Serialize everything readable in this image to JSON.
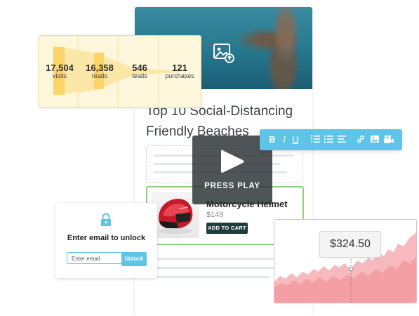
{
  "article": {
    "title_line1": "Top 10 Social-Distancing",
    "title_line2": "Friendly Beaches",
    "hero_icon": "image-upload-icon"
  },
  "product": {
    "name": "Motorcycle Helmet",
    "price": "$149",
    "cart_label": "ADD TO CART"
  },
  "video": {
    "label": "PRESS PLAY",
    "icon": "play-icon"
  },
  "toolbar": {
    "items": [
      "B",
      "I",
      "U"
    ],
    "icons": [
      "ordered-list-icon",
      "unordered-list-icon",
      "align-left-icon",
      "link-icon",
      "image-icon",
      "video-icon"
    ]
  },
  "funnel": {
    "stages": [
      {
        "value": "17,504",
        "label": "visits"
      },
      {
        "value": "16,358",
        "label": "reads"
      },
      {
        "value": "546",
        "label": "leads"
      },
      {
        "value": "121",
        "label": "purchases"
      }
    ]
  },
  "unlock": {
    "heading": "Enter email to unlock",
    "placeholder": "Enter email",
    "button": "Unlock"
  },
  "chart": {
    "price": "$324.50",
    "color": "#f1a3a8"
  }
}
